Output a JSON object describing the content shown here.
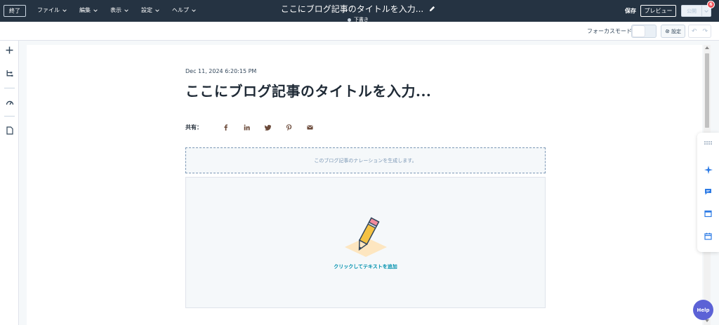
{
  "topbar": {
    "exit_label": "終了",
    "menu": [
      {
        "label": "ファイル"
      },
      {
        "label": "編集"
      },
      {
        "label": "表示"
      },
      {
        "label": "設定"
      },
      {
        "label": "ヘルプ"
      }
    ],
    "doc_title": "ここにブログ記事のタイトルを入力...",
    "doc_status": "下書き",
    "save_label": "保存",
    "preview_label": "プレビュー",
    "publish_label": "公開",
    "notification_count": "6"
  },
  "toolbar": {
    "focus_mode_label": "フォーカスモード",
    "settings_label": "設定"
  },
  "post": {
    "date": "Dec 11, 2024 6:20:15 PM",
    "title": "ここにブログ記事のタイトルを入力...",
    "share_label": "共有：",
    "share_icons": [
      "facebook-icon",
      "linkedin-icon",
      "twitter-icon",
      "pinterest-icon",
      "email-icon"
    ],
    "narration_placeholder": "このブログ記事のナレーションを生成します。",
    "add_text_label": "クリックしてテキストを追加"
  },
  "help_label": "Help",
  "colors": {
    "topbar_bg": "#253342",
    "accent_link": "#0091ae",
    "help_bg": "#5c62d6",
    "badge": "#f2545b"
  }
}
